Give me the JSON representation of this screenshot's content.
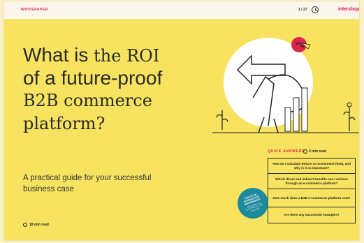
{
  "header": {
    "label": "WHITEPAPER",
    "page_indicator": "1 / 27",
    "logo_text": "intershop"
  },
  "hero": {
    "title_part1": "What is ",
    "title_part2": "the ROI",
    "title_part3": "of a future-proof",
    "title_part4": "B2B commerce",
    "title_part5": "platform?",
    "subtitle": "A practical guide for your successful business case",
    "read_time": "18 min read"
  },
  "quick_answers": {
    "heading": "QUICK ANSWERS",
    "read_time": "2 min read",
    "items": [
      "How do I calculate Return on Investment (ROI), and why is it so important?",
      "Which direct and indirect benefits can I achieve through an e-commerce platform?",
      "How much does a B2B e-commerce platform cost?",
      "Are there any successful examples?"
    ]
  },
  "badge": {
    "line1": "THIS IS AN INTERACTIVE WHITEPAPER!",
    "line2": "FEEL FREE TO EXPLORE ALL THE CONTENT"
  },
  "colors": {
    "background": "#f7e35f",
    "accent": "#d9264a",
    "badge": "#1e8a9e"
  }
}
